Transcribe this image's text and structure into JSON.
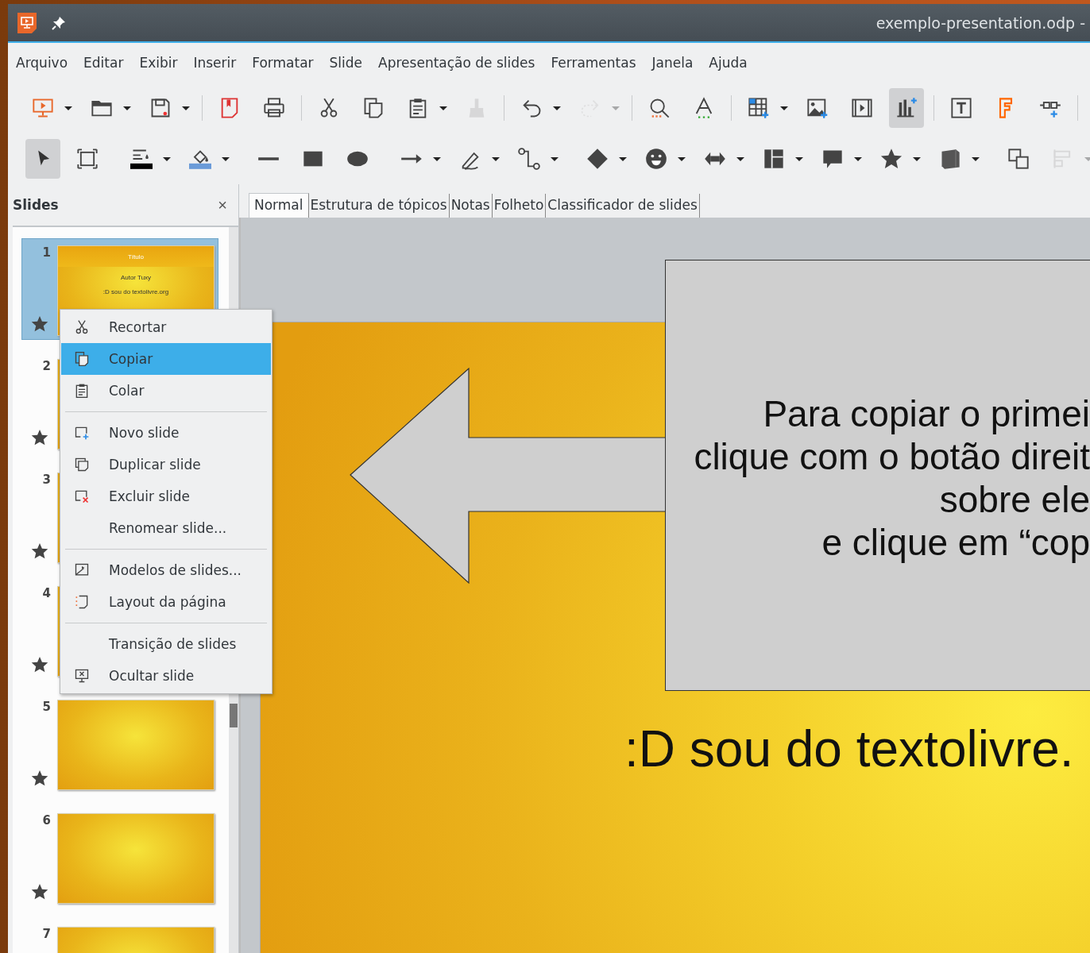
{
  "window": {
    "title": "exemplo-presentation.odp -"
  },
  "menu_bar": [
    "Arquivo",
    "Editar",
    "Exibir",
    "Inserir",
    "Formatar",
    "Slide",
    "Apresentação de slides",
    "Ferramentas",
    "Janela",
    "Ajuda"
  ],
  "toolbars": [
    [
      {
        "kind": "button",
        "dropdown": true,
        "disabled": false,
        "pressed": false
      },
      {
        "kind": "button",
        "dropdown": true,
        "disabled": false,
        "pressed": false
      },
      {
        "kind": "button",
        "dropdown": true,
        "disabled": false,
        "pressed": false
      },
      {
        "kind": "separator"
      },
      {
        "kind": "button",
        "dropdown": false,
        "disabled": false,
        "pressed": false
      },
      {
        "kind": "button",
        "dropdown": false,
        "disabled": false,
        "pressed": false
      },
      {
        "kind": "separator"
      },
      {
        "kind": "button",
        "dropdown": false,
        "disabled": false,
        "pressed": false
      },
      {
        "kind": "button",
        "dropdown": false,
        "disabled": false,
        "pressed": false
      },
      {
        "kind": "button",
        "dropdown": true,
        "disabled": false,
        "pressed": false
      },
      {
        "kind": "button",
        "dropdown": false,
        "disabled": true,
        "pressed": false
      },
      {
        "kind": "separator"
      },
      {
        "kind": "button",
        "dropdown": true,
        "disabled": false,
        "pressed": false
      },
      {
        "kind": "button",
        "dropdown": true,
        "disabled": true,
        "pressed": false
      },
      {
        "kind": "separator"
      },
      {
        "kind": "button",
        "dropdown": false,
        "disabled": false,
        "pressed": false
      },
      {
        "kind": "button",
        "dropdown": false,
        "disabled": false,
        "pressed": false
      },
      {
        "kind": "separator"
      },
      {
        "kind": "button",
        "dropdown": true,
        "disabled": false,
        "pressed": false
      },
      {
        "kind": "button",
        "dropdown": false,
        "disabled": false,
        "pressed": false
      },
      {
        "kind": "button",
        "dropdown": false,
        "disabled": false,
        "pressed": false
      },
      {
        "kind": "button",
        "dropdown": false,
        "disabled": false,
        "pressed": true
      },
      {
        "kind": "separator"
      },
      {
        "kind": "button",
        "dropdown": false,
        "disabled": false,
        "pressed": false
      },
      {
        "kind": "button",
        "dropdown": false,
        "disabled": false,
        "pressed": false
      },
      {
        "kind": "button",
        "dropdown": false,
        "disabled": false,
        "pressed": false
      },
      {
        "kind": "separator"
      }
    ],
    [
      {
        "kind": "button",
        "dropdown": false,
        "disabled": false,
        "pressed": true
      },
      {
        "kind": "button",
        "dropdown": false,
        "disabled": false,
        "pressed": false
      },
      {
        "kind": "separator"
      },
      {
        "kind": "button",
        "dropdown": true,
        "disabled": false,
        "pressed": false
      },
      {
        "kind": "button",
        "dropdown": true,
        "disabled": false,
        "pressed": false
      },
      {
        "kind": "separator"
      },
      {
        "kind": "button",
        "dropdown": false,
        "disabled": false,
        "pressed": false
      },
      {
        "kind": "button",
        "dropdown": false,
        "disabled": false,
        "pressed": false
      },
      {
        "kind": "button",
        "dropdown": false,
        "disabled": false,
        "pressed": false
      },
      {
        "kind": "separator"
      },
      {
        "kind": "button",
        "dropdown": true,
        "disabled": false,
        "pressed": false
      },
      {
        "kind": "button",
        "dropdown": true,
        "disabled": false,
        "pressed": false
      },
      {
        "kind": "button",
        "dropdown": true,
        "disabled": false,
        "pressed": false
      },
      {
        "kind": "separator"
      },
      {
        "kind": "button",
        "dropdown": true,
        "disabled": false,
        "pressed": false
      },
      {
        "kind": "button",
        "dropdown": true,
        "disabled": false,
        "pressed": false
      },
      {
        "kind": "button",
        "dropdown": true,
        "disabled": false,
        "pressed": false
      },
      {
        "kind": "button",
        "dropdown": true,
        "disabled": false,
        "pressed": false
      },
      {
        "kind": "button",
        "dropdown": true,
        "disabled": false,
        "pressed": false
      },
      {
        "kind": "button",
        "dropdown": true,
        "disabled": false,
        "pressed": false
      },
      {
        "kind": "button",
        "dropdown": true,
        "disabled": false,
        "pressed": false
      },
      {
        "kind": "separator"
      },
      {
        "kind": "button",
        "dropdown": false,
        "disabled": false,
        "pressed": false
      },
      {
        "kind": "button",
        "dropdown": true,
        "disabled": true,
        "pressed": false
      }
    ]
  ],
  "slides_panel": {
    "title": "Slides",
    "close": "×",
    "slides": [
      {
        "number": "1",
        "selected": true,
        "title": "Título",
        "subtitle": "Autor Tuxy",
        "footer": ":D sou do textolivre.org"
      },
      {
        "number": "2",
        "selected": false
      },
      {
        "number": "3",
        "selected": false
      },
      {
        "number": "4",
        "selected": false
      },
      {
        "number": "5",
        "selected": false
      },
      {
        "number": "6",
        "selected": false
      },
      {
        "number": "7",
        "selected": false
      }
    ]
  },
  "view_tabs": [
    {
      "label": "Normal",
      "selected": true
    },
    {
      "label": "Estrutura de tópicos",
      "selected": false
    },
    {
      "label": "Notas",
      "selected": false
    },
    {
      "label": "Folheto",
      "selected": false
    },
    {
      "label": "Classificador de slides",
      "selected": false
    }
  ],
  "slide": {
    "callout_lines": [
      "Para copiar o primei",
      "clique com o botão direit",
      "sobre ele",
      "e clique em “cop"
    ],
    "footer_text": ":D sou do textolivre."
  },
  "context_menu": [
    {
      "kind": "item",
      "label": "Recortar",
      "selected": false
    },
    {
      "kind": "item",
      "label": "Copiar",
      "selected": true
    },
    {
      "kind": "item",
      "label": "Colar",
      "selected": false
    },
    {
      "kind": "separator"
    },
    {
      "kind": "item",
      "label": "Novo slide",
      "selected": false
    },
    {
      "kind": "item",
      "label": "Duplicar slide",
      "selected": false
    },
    {
      "kind": "item",
      "label": "Excluir slide",
      "selected": false
    },
    {
      "kind": "item",
      "label": "Renomear slide...",
      "selected": false
    },
    {
      "kind": "separator"
    },
    {
      "kind": "item",
      "label": "Modelos de slides...",
      "selected": false
    },
    {
      "kind": "item",
      "label": "Layout da página",
      "selected": false
    },
    {
      "kind": "separator"
    },
    {
      "kind": "item",
      "label": "Transição de slides",
      "selected": false
    },
    {
      "kind": "item",
      "label": "Ocultar slide",
      "selected": false
    }
  ]
}
